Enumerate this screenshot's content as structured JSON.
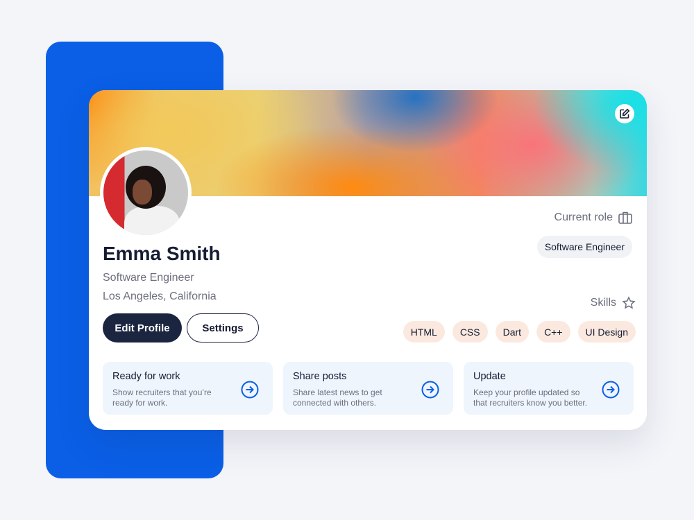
{
  "profile": {
    "name": "Emma Smith",
    "title": "Software Engineer",
    "location": "Los Angeles, California"
  },
  "buttons": {
    "edit": "Edit Profile",
    "settings": "Settings"
  },
  "current_role": {
    "label": "Current role",
    "value": "Software Engineer"
  },
  "skills": {
    "label": "Skills",
    "items": [
      "HTML",
      "CSS",
      "Dart",
      "C++",
      "UI Design"
    ]
  },
  "tiles": [
    {
      "title": "Ready for work",
      "desc": "Show recruiters that you’re ready for work."
    },
    {
      "title": "Share posts",
      "desc": "Share latest news to get connected with others."
    },
    {
      "title": "Update",
      "desc": "Keep your profile updated so that recruiters know you better."
    }
  ],
  "colors": {
    "accent": "#0a5fe6",
    "dark": "#1b2540",
    "chip": "#fbe9df"
  }
}
